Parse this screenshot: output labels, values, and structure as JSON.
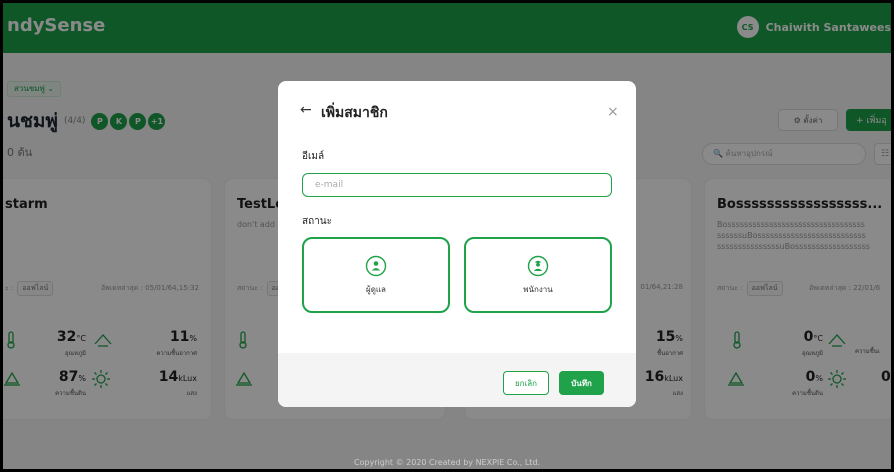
{
  "header": {
    "brand": "ndySense",
    "user_initials": "CS",
    "user_name": "Chaiwith Santawees"
  },
  "page": {
    "breadcrumb": "สวนชมพู่ ⌄",
    "title": "นชมพู่",
    "member_count": "(4/4)",
    "member_chips": [
      "P",
      "K",
      "P",
      "+1"
    ],
    "subtitle": "0 ต้น",
    "settings_label": "⚙ ตั้งค่า",
    "add_label": "+ เพิ่มอุ",
    "search_placeholder": "🔍 ค้นหาอุปกรณ์",
    "filter_icon": "☷"
  },
  "cards": [
    {
      "title": "starm",
      "desc": "",
      "status_prefix": "ะ :",
      "status": "ออฟไลน์",
      "updated": "อัพเดทล่าสุด : 05/01/64,15:32",
      "temp": "32",
      "temp_unit": "°C",
      "temp_label": "อุณหภูมิ",
      "humidity_air": "11",
      "humidity_air_unit": "%",
      "humidity_air_label": "ความชื้นอากาศ",
      "soil": "87",
      "soil_unit": "%",
      "soil_label": "ความชื้นดิน",
      "light": "14",
      "light_unit": "kLux",
      "light_label": "แสง"
    },
    {
      "title": "TestLo",
      "desc": "don't add",
      "status_prefix": "สถานะ :",
      "status": "ออ"
    },
    {
      "updated": "01/64,21:28",
      "humidity_air": "15",
      "humidity_air_unit": "%",
      "humidity_air_label": "ชื้นอากาศ",
      "light": "16",
      "light_unit": "kLux",
      "light_label": "แสง"
    },
    {
      "title": "Bosssssssssssssssss...",
      "desc_lines": [
        "Bosssssssssssssssssssssssssssssssss",
        "ssssssuBossssssssssssssssssssssssss",
        "sssssssssssssssuBossssssssssssssssss"
      ],
      "status_prefix": "สถานะ :",
      "status": "ออฟไลน์",
      "updated": "อัพเดทล่าสุด : 22/01/6",
      "temp": "0",
      "temp_unit": "°C",
      "temp_label": "อุณหภูมิ",
      "humidity_air": "0",
      "humidity_air_label": "ความชื้นเ",
      "soil": "0",
      "soil_unit": "%",
      "soil_label": "ความชื้นดิน"
    }
  ],
  "footer": "Copyright © 2020 Created by NEXPIE Co., Ltd.",
  "modal": {
    "back_icon": "←",
    "title": "เพิ่มสมาชิก",
    "close_icon": "×",
    "email_label": "อีเมล์",
    "email_placeholder": "e-mail",
    "email_value": "",
    "status_label": "สถานะ",
    "roles": [
      {
        "label": "ผู้ดูแล",
        "icon": "admin-icon"
      },
      {
        "label": "พนักงาน",
        "icon": "employee-icon"
      }
    ],
    "cancel_label": "ยกเลิก",
    "save_label": "บันทึก"
  },
  "colors": {
    "brand": "#1fa24a",
    "overlay": "rgba(0,0,0,0.46)"
  }
}
